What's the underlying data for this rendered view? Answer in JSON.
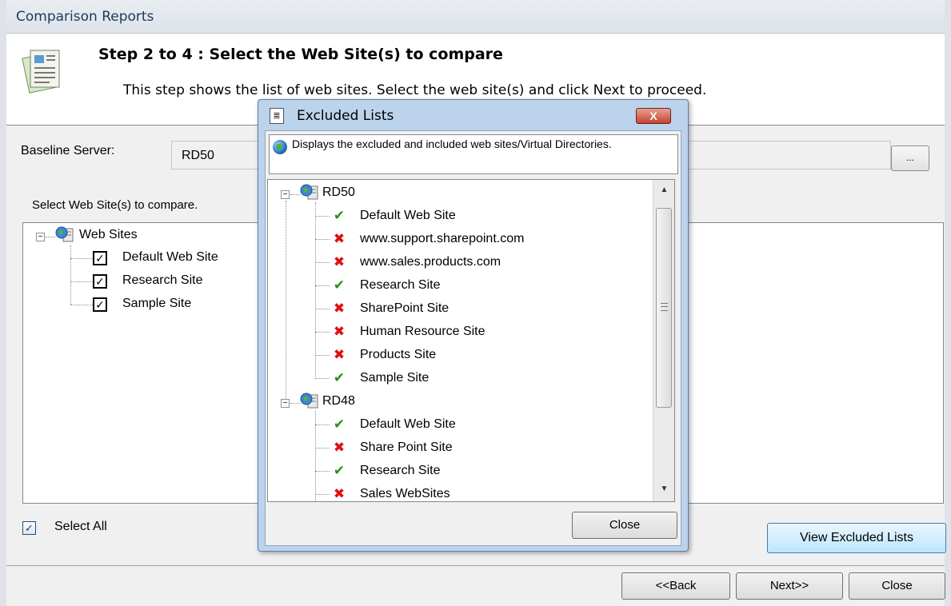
{
  "window": {
    "title": "Comparison Reports"
  },
  "header": {
    "step_title": "Step 2 to 4 : Select the Web Site(s) to compare",
    "step_desc": "This step shows the list of web sites. Select the web site(s) and click Next to proceed."
  },
  "baseline": {
    "label": "Baseline Server:",
    "value": "RD50",
    "browse_label": "..."
  },
  "site_select": {
    "label": "Select Web Site(s) to compare.",
    "root": "Web Sites",
    "items": [
      {
        "label": "Default Web Site",
        "checked": true
      },
      {
        "label": "Research Site",
        "checked": true
      },
      {
        "label": "Sample Site",
        "checked": true
      }
    ]
  },
  "select_all": {
    "label": "Select All",
    "checked": true
  },
  "view_excluded_label": "View Excluded Lists",
  "footer": {
    "back": "<<Back",
    "next": "Next>>",
    "close": "Close"
  },
  "dialog": {
    "title": "Excluded Lists",
    "close_x": "X",
    "description": "Displays the excluded and included web sites/Virtual Directories.",
    "servers": [
      {
        "name": "RD50",
        "sites": [
          {
            "label": "Default Web Site",
            "included": true
          },
          {
            "label": "www.support.sharepoint.com",
            "included": false
          },
          {
            "label": "www.sales.products.com",
            "included": false
          },
          {
            "label": "Research Site",
            "included": true
          },
          {
            "label": "SharePoint Site",
            "included": false
          },
          {
            "label": "Human Resource Site",
            "included": false
          },
          {
            "label": "Products Site",
            "included": false
          },
          {
            "label": "Sample Site",
            "included": true
          }
        ]
      },
      {
        "name": "RD48",
        "sites": [
          {
            "label": "Default Web Site",
            "included": true
          },
          {
            "label": "Share Point Site",
            "included": false
          },
          {
            "label": "Research Site",
            "included": true
          },
          {
            "label": "Sales WebSites",
            "included": false
          }
        ]
      }
    ],
    "close_label": "Close"
  },
  "icons": {
    "ok": "check-mark-icon",
    "bad": "x-mark-icon",
    "ok_color": "#2e8b1e",
    "bad_color": "#e01010"
  }
}
